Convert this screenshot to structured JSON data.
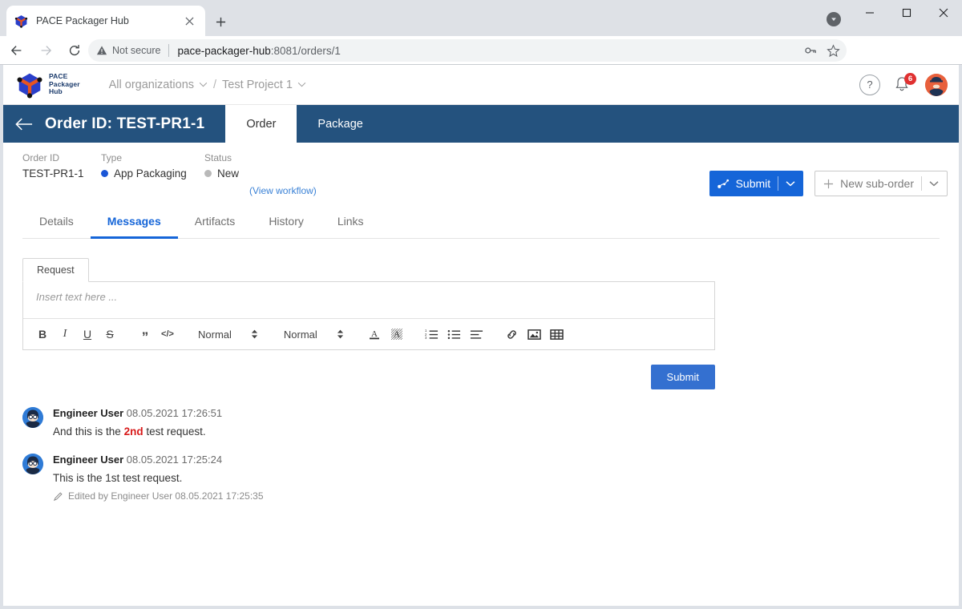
{
  "browser": {
    "tab": {
      "title": "PACE Packager Hub",
      "favicon_icon": "pace-cube-icon",
      "close_icon": "close-icon"
    },
    "new_tab_label": "+",
    "window_controls": {
      "minimize": "–",
      "maximize": "□",
      "close": "✕"
    },
    "download_icon": "download-arrow-icon",
    "nav": {
      "back_icon": "arrow-left-icon",
      "forward_icon": "arrow-right-icon",
      "reload_icon": "reload-icon"
    },
    "omnibox": {
      "security_label": "Not secure",
      "security_icon": "warning-triangle-icon",
      "url_host": "pace-packager-hub",
      "url_path": ":8081/orders/1",
      "key_icon": "key-icon",
      "star_icon": "star-icon"
    },
    "profile_icon": "profile-avatar-icon",
    "menu_icon": "three-dot-menu-icon"
  },
  "app_header": {
    "logo": {
      "line1": "PACE",
      "line2": "Packager",
      "line3": "Hub"
    },
    "breadcrumb": [
      {
        "label": "All organizations",
        "caret": "⌄"
      },
      {
        "label": "Test Project 1",
        "caret": "⌄"
      }
    ],
    "breadcrumb_separator": "/",
    "help_label": "?",
    "notifications_count": "6",
    "bell_icon": "bell-icon",
    "avatar_icon": "user-avatar-icon"
  },
  "order_bar": {
    "back_icon": "arrow-left-icon",
    "title": "Order ID: TEST-PR1-1",
    "tabs": [
      {
        "label": "Order",
        "active": true
      },
      {
        "label": "Package",
        "active": false
      }
    ]
  },
  "meta": {
    "order_id": {
      "label": "Order ID",
      "value": "TEST-PR1-1"
    },
    "type": {
      "label": "Type",
      "value": "App Packaging",
      "dot_color": "#1a56d6"
    },
    "status": {
      "label": "Status",
      "value": "New",
      "dot_color": "#b9b9b9"
    },
    "view_workflow": "(View workflow)"
  },
  "actions": {
    "submit": {
      "label": "Submit",
      "icon": "workflow-nodes-icon",
      "caret": "⌄",
      "color": "#1565d8"
    },
    "new_suborder": {
      "label": "New sub-order",
      "icon": "plus-icon",
      "caret": "⌄"
    }
  },
  "subtabs": [
    {
      "label": "Details",
      "active": false
    },
    {
      "label": "Messages",
      "active": true
    },
    {
      "label": "Artifacts",
      "active": false
    },
    {
      "label": "History",
      "active": false
    },
    {
      "label": "Links",
      "active": false
    }
  ],
  "editor": {
    "tab_label": "Request",
    "placeholder": "Insert text here ...",
    "value": "",
    "toolbar": {
      "bold": "B",
      "italic": "I",
      "underline": "U",
      "strike": "S",
      "blockquote": "”",
      "code": "</>",
      "font_select": "Normal",
      "size_select": "Normal",
      "font_color_icon": "font-color-icon",
      "highlight_color_icon": "highlight-color-icon",
      "ordered_list_icon": "ordered-list-icon",
      "bullet_list_icon": "bullet-list-icon",
      "align_icon": "align-left-icon",
      "link_icon": "link-icon",
      "image_icon": "image-icon",
      "table_icon": "table-icon"
    },
    "submit_label": "Submit"
  },
  "messages": [
    {
      "author": "Engineer User",
      "timestamp": "08.05.2021 17:26:51",
      "text_before": "And this is the ",
      "highlight": "2nd",
      "text_after": " test request.",
      "edited": ""
    },
    {
      "author": "Engineer User",
      "timestamp": "08.05.2021 17:25:24",
      "text_before": "This is the 1st test request.",
      "highlight": "",
      "text_after": "",
      "edited": "Edited by Engineer User 08.05.2021 17:25:35"
    }
  ]
}
